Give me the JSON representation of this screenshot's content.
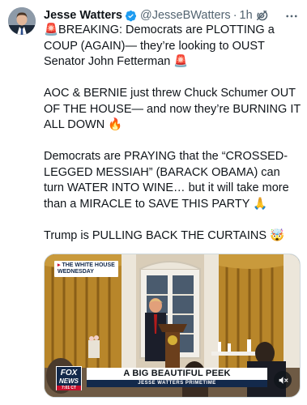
{
  "tweet": {
    "author_name": "Jesse Watters",
    "handle": "@JesseBWatters",
    "separator": "·",
    "time": "1h",
    "verified": true,
    "paragraphs": [
      "🚨BREAKING: Democrats are PLOTTING a COUP (AGAIN)— they’re looking to OUST Senator John Fetterman 🚨",
      "AOC & BERNIE just threw Chuck Schumer OUT OF THE HOUSE— and now they’re BURNING IT ALL DOWN 🔥",
      "Democrats are PRAYING that the “CROSSED-LEGGED MESSIAH” (BARACK OBAMA) can turn WATER INTO WINE… but it will take more than a MIRACLE to SAVE THIS PARTY 🙏",
      "Trump is PULLING BACK THE CURTAINS 🤯"
    ]
  },
  "media": {
    "top_chyron": {
      "arrow": "▸",
      "line1": "THE WHITE HOUSE",
      "line2": "WEDNESDAY"
    },
    "logo": {
      "line1": "FOX",
      "line2": "NEWS",
      "line3": "7:01 CT"
    },
    "lower_third": {
      "headline": "A BIG BEAUTIFUL PEEK",
      "show": "JESSE WATTERS PRIMETIME"
    }
  },
  "icons": {
    "verified": "verified-badge-icon",
    "grok": "grok-icon",
    "more": "more-icon",
    "mute": "speaker-muted-icon"
  },
  "colors": {
    "verified_blue": "#1d9bf0",
    "secondary_text": "#536471",
    "fox_navy": "#13294b",
    "fox_red": "#c8102e"
  }
}
